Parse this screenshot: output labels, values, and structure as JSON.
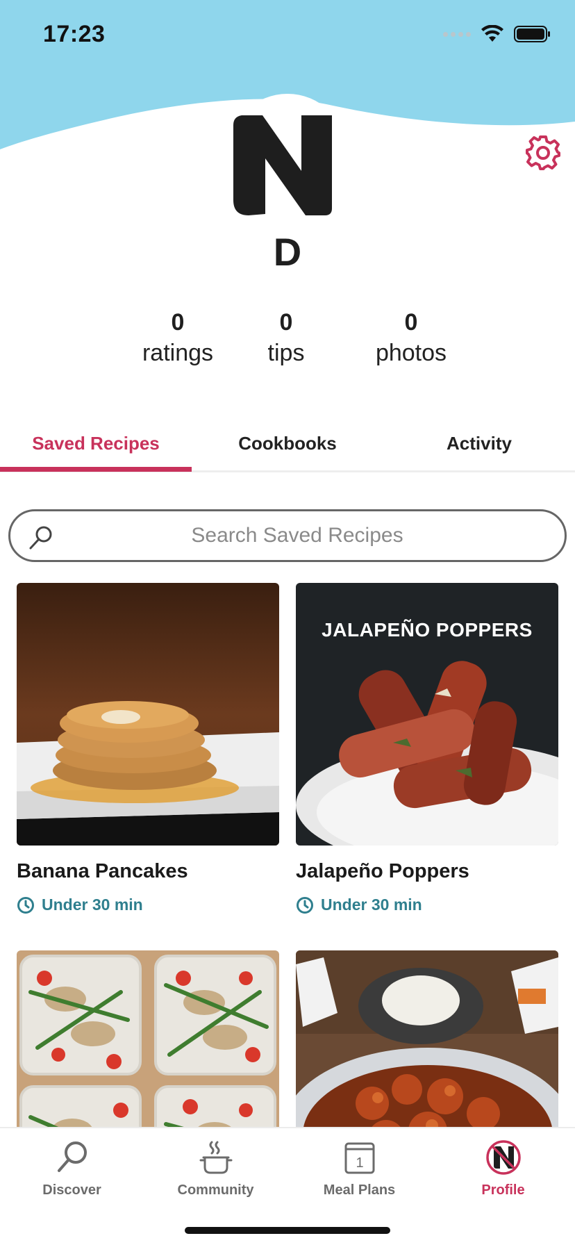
{
  "status_bar": {
    "time": "17:23"
  },
  "profile": {
    "initial": "D",
    "stats": [
      {
        "value": "0",
        "label": "ratings"
      },
      {
        "value": "0",
        "label": "tips"
      },
      {
        "value": "0",
        "label": "photos"
      }
    ]
  },
  "tabs": [
    {
      "label": "Saved Recipes",
      "active": true
    },
    {
      "label": "Cookbooks",
      "active": false
    },
    {
      "label": "Activity",
      "active": false
    }
  ],
  "search": {
    "placeholder": "Search Saved Recipes",
    "value": ""
  },
  "recipes": [
    {
      "title": "Banana Pancakes",
      "time": "Under 30 min",
      "image_text": ""
    },
    {
      "title": "Jalapeño Poppers",
      "time": "Under 30 min",
      "image_text": "JALAPEÑO POPPERS"
    },
    {
      "title": "",
      "time": "",
      "image_text": ""
    },
    {
      "title": "",
      "time": "",
      "image_text": ""
    }
  ],
  "bottom_nav": [
    {
      "label": "Discover",
      "icon": "search-icon"
    },
    {
      "label": "Community",
      "icon": "pot-icon"
    },
    {
      "label": "Meal Plans",
      "icon": "calendar-icon",
      "badge": "1"
    },
    {
      "label": "Profile",
      "icon": "profile-logo-icon",
      "active": true
    }
  ],
  "colors": {
    "accent": "#c8325b",
    "header_sky": "#8fd6ec",
    "time_teal": "#2f7f8e"
  }
}
